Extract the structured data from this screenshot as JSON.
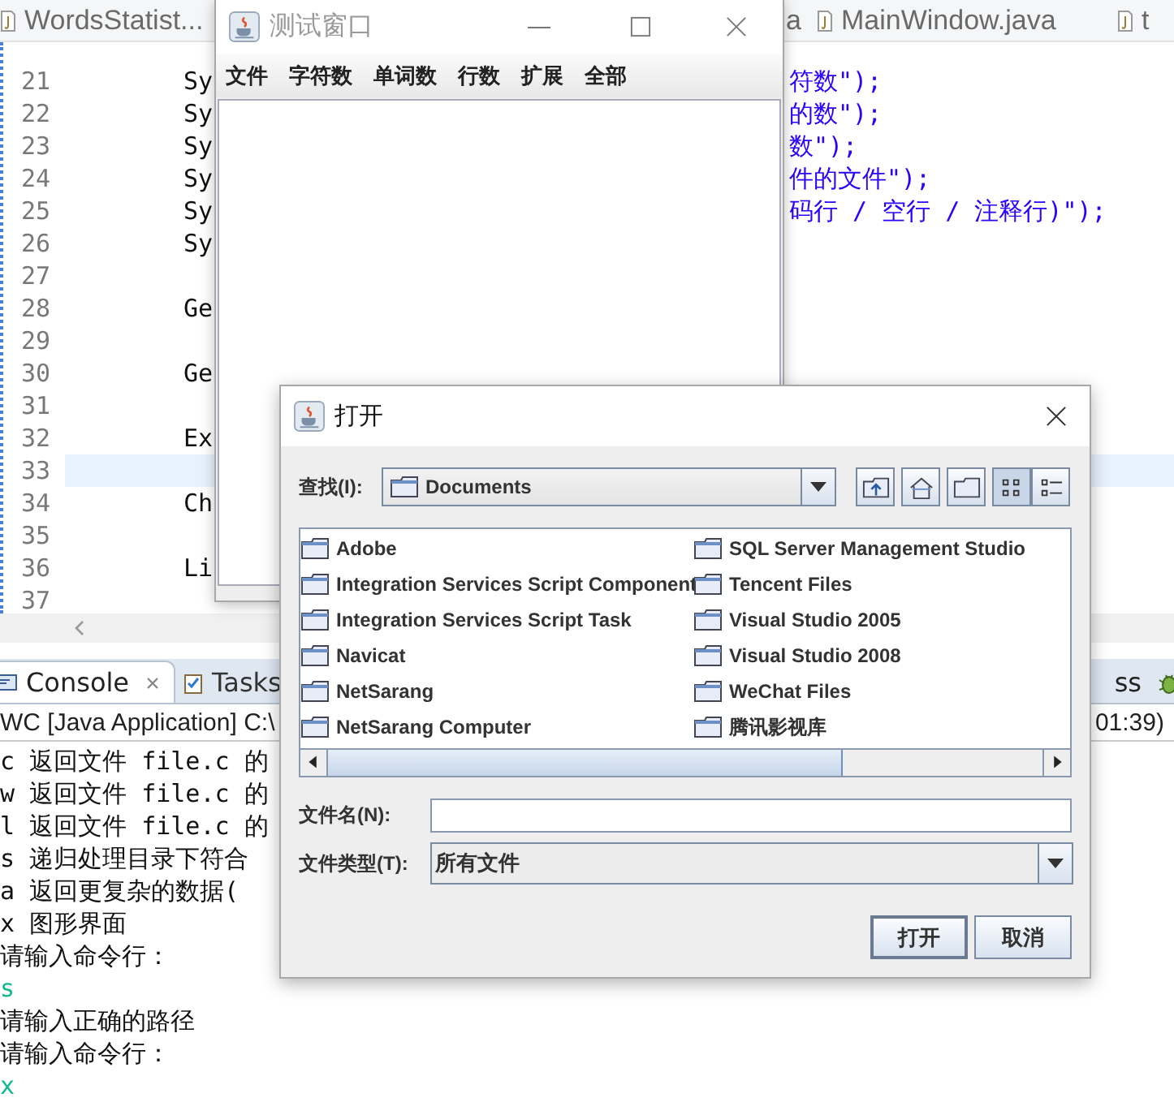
{
  "editor": {
    "tabs": [
      {
        "label": "WordsStatist..."
      },
      {
        "label": "a"
      },
      {
        "label": "MainWindow.java"
      },
      {
        "label": "t"
      }
    ],
    "lines": [
      {
        "number": "21",
        "left": "Sy",
        "right": "符数\");",
        "current": false
      },
      {
        "number": "22",
        "left": "Sy",
        "right": "的数\");",
        "current": false
      },
      {
        "number": "23",
        "left": "Sy",
        "right": "数\");",
        "current": false
      },
      {
        "number": "24",
        "left": "Sy",
        "right": "件的文件\");",
        "current": false
      },
      {
        "number": "25",
        "left": "Sy",
        "right": "码行 / 空行 / 注释行)\");",
        "current": false
      },
      {
        "number": "26",
        "left": "Sy",
        "current": false
      },
      {
        "number": "27",
        "current": false
      },
      {
        "number": "28",
        "left": "Ge",
        "current": false
      },
      {
        "number": "29",
        "current": false
      },
      {
        "number": "30",
        "left": "Ge",
        "current": false
      },
      {
        "number": "31",
        "current": false
      },
      {
        "number": "32",
        "left": "Ex",
        "current": false
      },
      {
        "number": "33",
        "current": true
      },
      {
        "number": "34",
        "left": "Ch",
        "current": false
      },
      {
        "number": "35",
        "current": false
      },
      {
        "number": "36",
        "left": "Li",
        "current": false
      },
      {
        "number": "37",
        "current": false
      }
    ]
  },
  "console": {
    "tabs": [
      {
        "label": "Console",
        "selected": true
      },
      {
        "label": "Tasks",
        "selected": false
      }
    ],
    "right_tabs": [
      {
        "label": "ss",
        "kind": "text"
      },
      {
        "kind": "debug"
      }
    ],
    "header": "WC [Java Application] C:\\",
    "header_right": "01:39)",
    "lines": [
      {
        "text": "c 返回文件 file.c 的",
        "kind": "output"
      },
      {
        "text": "w 返回文件 file.c 的",
        "kind": "output"
      },
      {
        "text": "l 返回文件 file.c 的",
        "kind": "output"
      },
      {
        "text": "s 递归处理目录下符合",
        "kind": "output"
      },
      {
        "text": "a 返回更复杂的数据(",
        "kind": "output"
      },
      {
        "text": "x 图形界面",
        "kind": "output"
      },
      {
        "text": "请输入命令行：",
        "kind": "output"
      },
      {
        "text": "s",
        "kind": "input"
      },
      {
        "text": "请输入正确的路径",
        "kind": "output"
      },
      {
        "text": "请输入命令行：",
        "kind": "output"
      },
      {
        "text": "x",
        "kind": "input"
      }
    ]
  },
  "test_window": {
    "title": "测试窗口",
    "menu": [
      "文件",
      "字符数",
      "单词数",
      "行数",
      "扩展",
      "全部"
    ]
  },
  "open_dialog": {
    "title": "打开",
    "look_in_label": "查找(I):",
    "look_in": "Documents",
    "toolbar": [
      {
        "kind": "up",
        "selected": false
      },
      {
        "kind": "home",
        "selected": false
      },
      {
        "kind": "new-folder",
        "selected": false
      },
      {
        "kind": "list",
        "selected": true
      },
      {
        "kind": "details",
        "selected": false
      }
    ],
    "files": [
      "Adobe",
      "Integration Services Script Component",
      "Integration Services Script Task",
      "Navicat",
      "NetSarang",
      "NetSarang Computer",
      "SQL Server Management Studio",
      "Tencent Files",
      "Visual Studio 2005",
      "Visual Studio 2008",
      "WeChat Files",
      "腾讯影视库"
    ],
    "file_name_label": "文件名(N):",
    "file_type_label": "文件类型(T):",
    "file_type": "所有文件",
    "buttons": [
      "打开",
      "取消"
    ]
  }
}
